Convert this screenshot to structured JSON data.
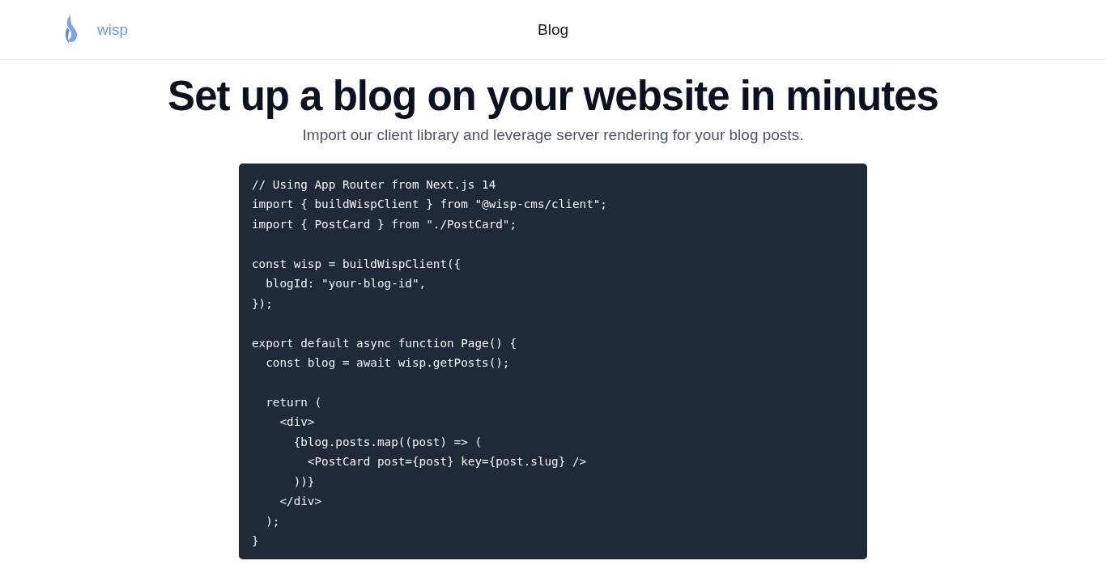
{
  "header": {
    "brand": "wisp",
    "nav": [
      {
        "label": "Blog"
      }
    ]
  },
  "hero": {
    "title": "Set up a blog on your website in minutes",
    "subtitle": "Import our client library and leverage server rendering for your blog posts."
  },
  "code": "// Using App Router from Next.js 14\nimport { buildWispClient } from \"@wisp-cms/client\";\nimport { PostCard } from \"./PostCard\";\n\nconst wisp = buildWispClient({\n  blogId: \"your-blog-id\",\n});\n\nexport default async function Page() {\n  const blog = await wisp.getPosts();\n\n  return (\n    <div>\n      {blog.posts.map((post) => (\n        <PostCard post={post} key={post.slug} />\n      ))}\n    </div>\n  );\n}"
}
